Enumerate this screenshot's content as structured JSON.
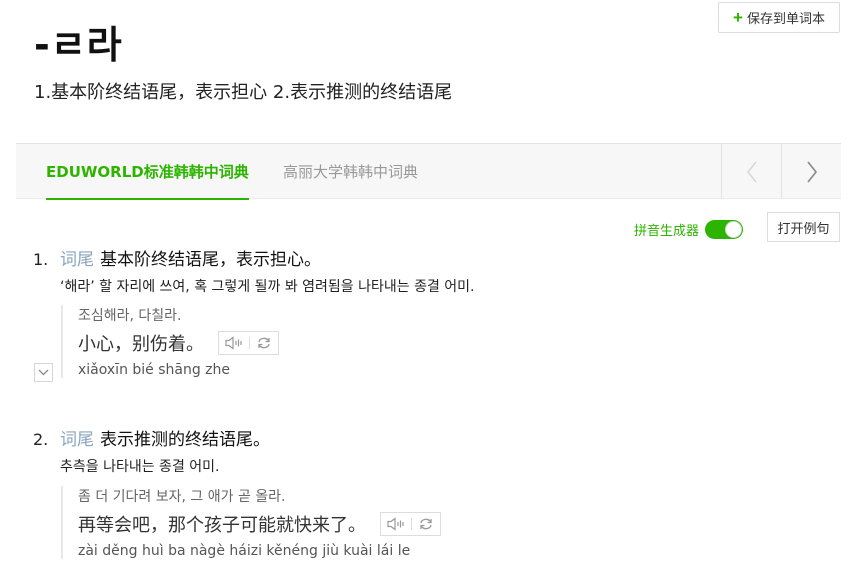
{
  "toolbar": {
    "save_label": "保存到单词本"
  },
  "entry": {
    "headword": "-ㄹ라",
    "summary": "1.基本阶终结语尾，表示担心  2.表示推测的终结语尾"
  },
  "tabs": [
    {
      "label": "EDUWORLD标准韩韩中词典",
      "active": true
    },
    {
      "label": "高丽大学韩韩中词典",
      "active": false
    }
  ],
  "controls": {
    "pinyin_label": "拼音生成器",
    "pinyin_on": true,
    "example_button": "打开例句"
  },
  "senses": [
    {
      "number": "1.",
      "pos": "词尾",
      "definition": "基本阶终结语尾，表示担心。",
      "ko_definition": "‘해라’ 할 자리에 쓰여, 혹 그렇게 될까 봐 염려됨을 나타내는 종결 어미.",
      "example": {
        "ko": "조심해라, 다칠라.",
        "zh": "小心，别伤着。",
        "pinyin": "xiǎoxīn bié shāng zhe"
      }
    },
    {
      "number": "2.",
      "pos": "词尾",
      "definition": "表示推测的终结语尾。",
      "ko_definition": "추측을 나타내는 종결 어미.",
      "example": {
        "ko": "좀 더 기다려 보자, 그 애가 곧 올라.",
        "zh": "再等会吧，那个孩子可能就快来了。",
        "pinyin": "zài děng huì ba nàgè háizi kěnéng jiù kuài lái le"
      }
    }
  ],
  "colors": {
    "accent": "#2db400",
    "pos": "#8aa4bd"
  }
}
